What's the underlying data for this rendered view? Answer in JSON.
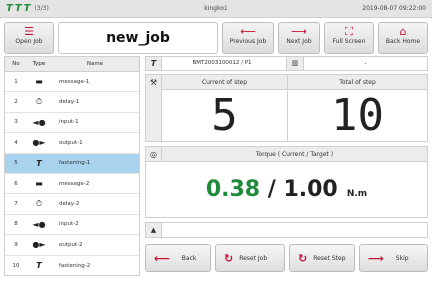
{
  "status": {
    "tool_count": "(3/3)",
    "device": "kingko1",
    "datetime": "2019-08-07 09:22:00"
  },
  "toolbar": {
    "open_job": "Open Job",
    "job_name": "new_job",
    "previous_job": "Previous Job",
    "next_job": "Next Job",
    "full_screen": "Full Screen",
    "back_home": "Back Home"
  },
  "steps": {
    "headers": {
      "no": "No",
      "type": "Type",
      "name": "Name"
    },
    "rows": [
      {
        "no": "1",
        "name": "message-1",
        "icon": "message-icon"
      },
      {
        "no": "2",
        "name": "delay-1",
        "icon": "timer-icon"
      },
      {
        "no": "3",
        "name": "input-1",
        "icon": "input-icon"
      },
      {
        "no": "4",
        "name": "output-1",
        "icon": "output-icon"
      },
      {
        "no": "5",
        "name": "fastening-1",
        "icon": "screwdriver-icon"
      },
      {
        "no": "6",
        "name": "message-2",
        "icon": "message-icon"
      },
      {
        "no": "7",
        "name": "delay-2",
        "icon": "timer-icon"
      },
      {
        "no": "8",
        "name": "input-2",
        "icon": "input-icon"
      },
      {
        "no": "9",
        "name": "output-2",
        "icon": "output-icon"
      },
      {
        "no": "10",
        "name": "fastening-2",
        "icon": "screwdriver-icon"
      }
    ],
    "selected_no": "5"
  },
  "info": {
    "tool_id": "BMT2003100012 / P1",
    "barcode_value": "-",
    "current_step_label": "Current of step",
    "current_step": "5",
    "total_step_label": "Total of step",
    "total_step": "10",
    "torque_label": "Torque ( Current / Target )",
    "torque_current": "0.38",
    "torque_sep": " / ",
    "torque_target": "1.00",
    "torque_unit": "N.m",
    "message": ""
  },
  "actions": {
    "back": "Back",
    "reset_job": "Reset Job",
    "reset_step": "Reset Step",
    "skip": "Skip"
  },
  "colors": {
    "accent": "#c8102e",
    "ok_green": "#1f8a3a",
    "selected_row": "#a8d2ee"
  }
}
